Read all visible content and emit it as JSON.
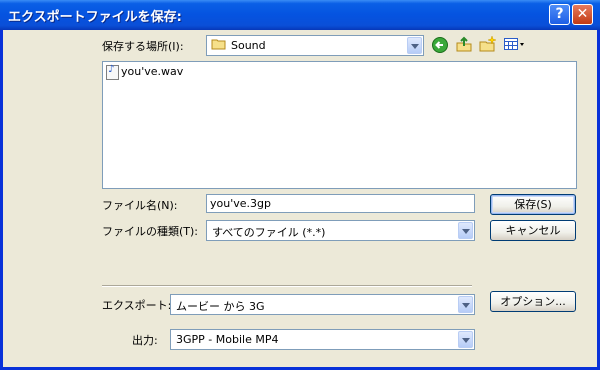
{
  "window": {
    "title": "エクスポートファイルを保存:",
    "help_glyph": "?",
    "close_glyph": "✕"
  },
  "savein": {
    "label": "保存する場所(I):",
    "value": "Sound"
  },
  "toolbar": {
    "icons": [
      "back-icon",
      "up-folder-icon",
      "new-folder-icon",
      "view-menu-icon"
    ]
  },
  "files": [
    {
      "name": "you've.wav"
    }
  ],
  "filename": {
    "label": "ファイル名(N):",
    "value": "you've.3gp"
  },
  "filetype": {
    "label": "ファイルの種類(T):",
    "value": "すべてのファイル (*.*)"
  },
  "export": {
    "label": "エクスポート:",
    "value": "ムービー から 3G"
  },
  "output": {
    "label": "出力:",
    "value": "3GPP - Mobile MP4"
  },
  "buttons": {
    "save": "保存(S)",
    "cancel": "キャンセル",
    "options": "オプション..."
  },
  "colors": {
    "title_bar": "#0553e0",
    "dialog_bg": "#ece9d8",
    "button_border": "#003c74"
  }
}
